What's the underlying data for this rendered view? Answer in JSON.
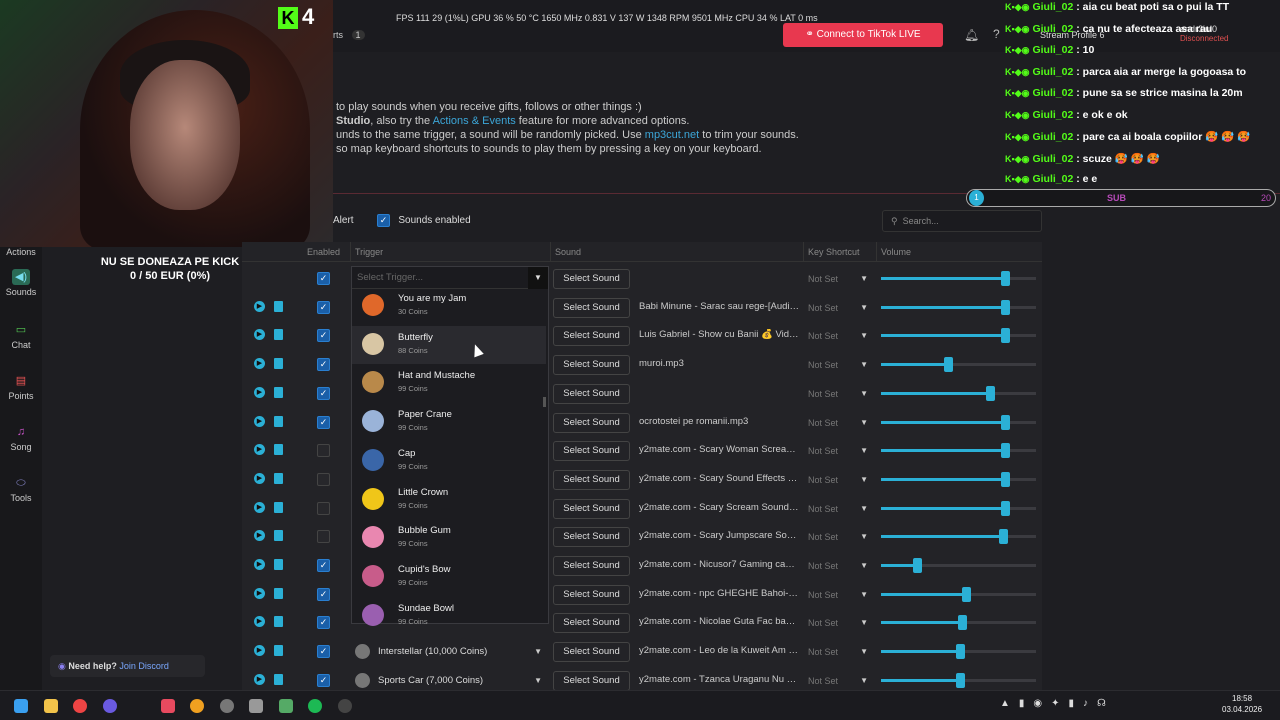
{
  "webcam": {
    "channel_badge": "K",
    "viewer_count": "4"
  },
  "donation": {
    "line1": "NU SE DONEAZA PE KICK",
    "line2": "0 / 50 EUR (0%)"
  },
  "sidebar": {
    "items": [
      {
        "label": "Actions",
        "icon": "actions-icon"
      },
      {
        "label": "Sounds",
        "icon": "speaker-icon"
      },
      {
        "label": "Chat",
        "icon": "chat-icon"
      },
      {
        "label": "Points",
        "icon": "points-icon"
      },
      {
        "label": "Song",
        "icon": "music-icon"
      },
      {
        "label": "Tools",
        "icon": "tools-icon"
      }
    ]
  },
  "help": {
    "text": "Need help?",
    "link": "Join Discord"
  },
  "topbar": {
    "partial_tab": "rts",
    "badge": "1",
    "stats": "FPS 111  29 (1%L)   GPU 36 %  50 °C  1650 MHz  0.831 V  137 W  1348 RPM  9501 MHz   CPU 34 %   LAT 0 ms",
    "tiktok_button": "Connect to TikTok LIVE",
    "profile": "Stream Profile 6",
    "account": "andr3iul0",
    "account_status": "Disconnected"
  },
  "hint": {
    "line1": "to play sounds when you receive gifts, follows or other things :)",
    "line2a": "Studio",
    "line2b": ", also try the ",
    "line2link": "Actions & Events",
    "line2c": " feature for more advanced options.",
    "line3a": "unds to the same trigger, a sound will be randomly picked. Use ",
    "line3link": "mp3cut.net",
    "line3b": " to trim your sounds.",
    "line4": "so map keyboard shortcuts to sounds to play them by pressing a key on your keyboard."
  },
  "chat": {
    "messages": [
      {
        "name": "Giuli_02",
        "text": "aia cu beat poti sa o pui la TT"
      },
      {
        "name": "Giuli_02",
        "text": "ca nu te afecteaza asa rau"
      },
      {
        "name": "Giuli_02",
        "text": "10"
      },
      {
        "name": "Giuli_02",
        "text": "parca aia ar merge la gogoasa to"
      },
      {
        "name": "Giuli_02",
        "text": "pune sa se strice masina la 20m"
      },
      {
        "name": "Giuli_02",
        "text": "e ok e ok"
      },
      {
        "name": "Giuli_02",
        "text": "pare ca ai boala copiilor 🥵 🥵 🥵"
      },
      {
        "name": "Giuli_02",
        "text": "scuze 🥵 🥵 🥵"
      },
      {
        "name": "Giuli_02",
        "text": "e e"
      }
    ]
  },
  "subgoal": {
    "current": "1",
    "label": "SUB",
    "target": "20"
  },
  "controls": {
    "alert_label": "Alert",
    "sounds_enabled": "Sounds enabled",
    "search_placeholder": "Search..."
  },
  "table": {
    "headers": {
      "enabled": "Enabled",
      "trigger": "Trigger",
      "sound": "Sound",
      "key": "Key Shortcut",
      "volume": "Volume"
    },
    "select_sound": "Select Sound",
    "not_set": "Not Set",
    "rows": [
      {
        "enabled": true,
        "trigger": "",
        "file": "",
        "volume": 0.8
      },
      {
        "enabled": true,
        "trigger": "",
        "file": "Babi Minune - Sarac sau rege-[Audio...",
        "volume": 0.8
      },
      {
        "enabled": true,
        "trigger": "",
        "file": "Luis Gabriel - Show cu Banii 💰 Vide...",
        "volume": 0.8
      },
      {
        "enabled": true,
        "trigger": "",
        "file": "muroi.mp3",
        "volume": 0.43
      },
      {
        "enabled": true,
        "trigger": "",
        "file": "",
        "volume": 0.7
      },
      {
        "enabled": true,
        "trigger": "",
        "file": "ocrotostei pe romanii.mp3",
        "volume": 0.8
      },
      {
        "enabled": false,
        "trigger": "",
        "file": "y2mate.com - Scary Woman Screami...",
        "volume": 0.8
      },
      {
        "enabled": false,
        "trigger": "",
        "file": "y2mate.com - Scary Sound Effects Ho...",
        "volume": 0.8
      },
      {
        "enabled": false,
        "trigger": "",
        "file": "y2mate.com - Scary Scream Sound Ef...",
        "volume": 0.8
      },
      {
        "enabled": false,
        "trigger": "",
        "file": "y2mate.com - Scary Jumpscare Soun...",
        "volume": 0.79
      },
      {
        "enabled": true,
        "trigger": "",
        "file": "y2mate.com - Nicusor7 Gaming cant...",
        "volume": 0.23
      },
      {
        "enabled": true,
        "trigger": "",
        "file": "y2mate.com - npc GHEGHE Bahoi-[A...",
        "volume": 0.55
      },
      {
        "enabled": true,
        "trigger": "",
        "file": "y2mate.com - Nicolae Guta Fac banii ...",
        "volume": 0.52
      },
      {
        "enabled": true,
        "trigger": "Interstellar (10,000 Coins)",
        "file": "y2mate.com - Leo de la Kuweit Am b...",
        "volume": 0.51
      },
      {
        "enabled": true,
        "trigger": "Sports Car (7,000 Coins)",
        "file": "y2mate.com - Tzanca Uraganu Nu co...",
        "volume": 0.51
      }
    ]
  },
  "dropdown": {
    "placeholder": "Select Trigger...",
    "options": [
      {
        "name": "You are my Jam",
        "coins": "30 Coins",
        "color": "#e0682a"
      },
      {
        "name": "Butterfly",
        "coins": "88 Coins",
        "color": "#d8c6a4"
      },
      {
        "name": "Hat and Mustache",
        "coins": "99 Coins",
        "color": "#b9894a"
      },
      {
        "name": "Paper Crane",
        "coins": "99 Coins",
        "color": "#9ab3d8"
      },
      {
        "name": "Cap",
        "coins": "99 Coins",
        "color": "#3a66a8"
      },
      {
        "name": "Little Crown",
        "coins": "99 Coins",
        "color": "#f0c619"
      },
      {
        "name": "Bubble Gum",
        "coins": "99 Coins",
        "color": "#e987b0"
      },
      {
        "name": "Cupid's Bow",
        "coins": "99 Coins",
        "color": "#c85c8a"
      },
      {
        "name": "Sundae Bowl",
        "coins": "99 Coins",
        "color": "#9a5fb0"
      }
    ]
  },
  "clock": {
    "time": "18:58",
    "date": "03.04.2026"
  }
}
